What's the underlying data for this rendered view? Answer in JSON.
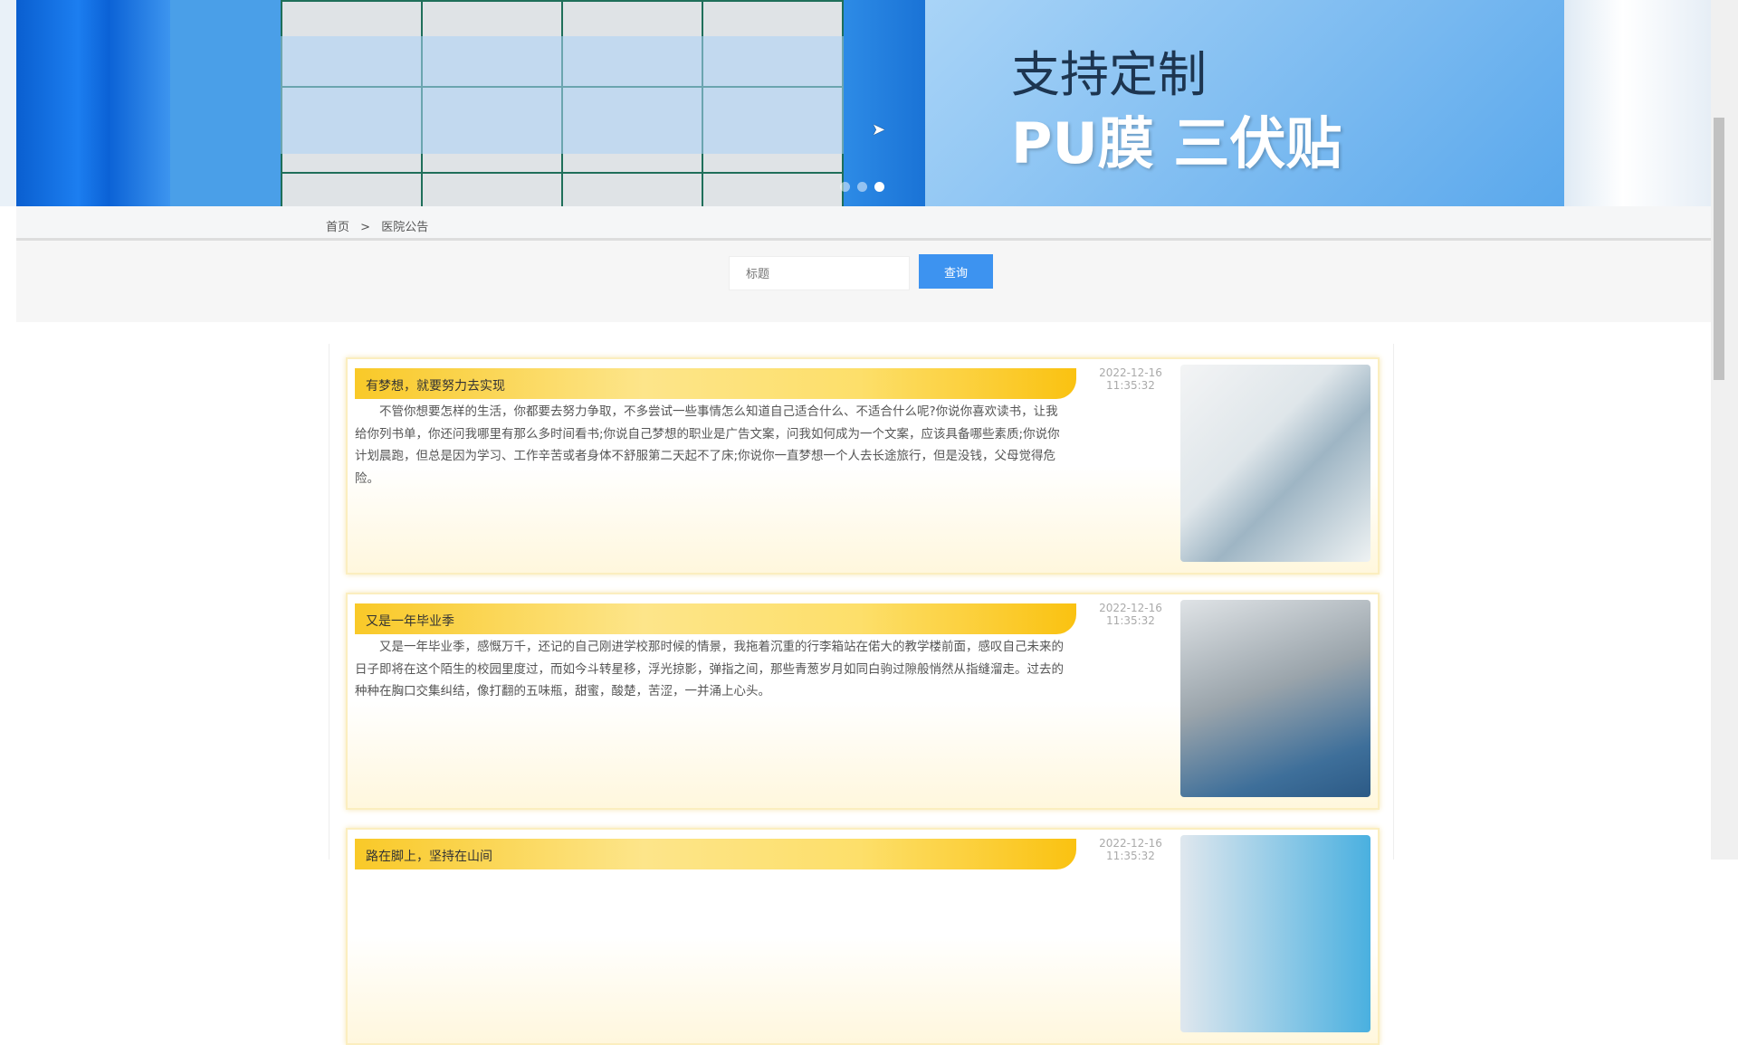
{
  "banner": {
    "line1": "支持定制",
    "line2": "PU膜 三伏贴",
    "dots": 3,
    "active_dot": 3
  },
  "breadcrumb": {
    "home": "首页",
    "sep": ">",
    "current": "医院公告"
  },
  "search": {
    "placeholder": "标题",
    "button": "查询"
  },
  "articles": [
    {
      "title": "有梦想，就要努力去实现",
      "date": "2022-12-16",
      "time": "11:35:32",
      "body": "不管你想要怎样的生活，你都要去努力争取，不多尝试一些事情怎么知道自己适合什么、不适合什么呢?你说你喜欢读书，让我给你列书单，你还问我哪里有那么多时间看书;你说自己梦想的职业是广告文案，问我如何成为一个文案，应该具备哪些素质;你说你计划晨跑，但总是因为学习、工作辛苦或者身体不舒服第二天起不了床;你说你一直梦想一个人去长途旅行，但是没钱，父母觉得危险。"
    },
    {
      "title": "又是一年毕业季",
      "date": "2022-12-16",
      "time": "11:35:32",
      "body": "又是一年毕业季，感慨万千，还记的自己刚进学校那时候的情景，我拖着沉重的行李箱站在偌大的教学楼前面，感叹自己未来的日子即将在这个陌生的校园里度过，而如今斗转星移，浮光掠影，弹指之间，那些青葱岁月如同白驹过隙般悄然从指缝溜走。过去的种种在胸口交集纠结，像打翻的五味瓶，甜蜜，酸楚，苦涩，一并涌上心头。"
    },
    {
      "title": "路在脚上，坚持在山间",
      "date": "2022-12-16",
      "time": "11:35:32",
      "body": ""
    }
  ]
}
